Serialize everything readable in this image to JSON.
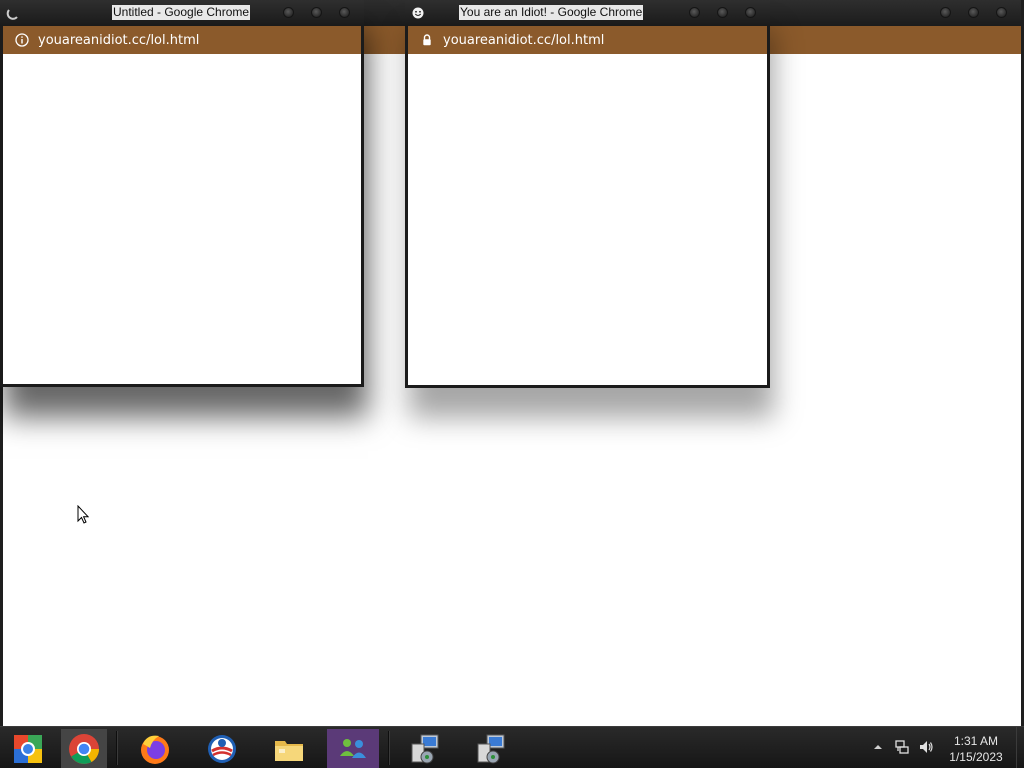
{
  "popups": [
    {
      "title": "Untitled - Google Chrome",
      "url": "youareanidiot.cc/lol.html",
      "title_icon": "loading-spinner-icon",
      "url_icon": "info-icon"
    },
    {
      "title": "You are an Idiot! - Google Chrome",
      "url": "youareanidiot.cc/lol.html",
      "title_icon": "smiley-face-icon",
      "url_icon": "lock-icon"
    }
  ],
  "colors": {
    "urlbar": "#8b5a2b",
    "titlebar": "#1e1e1e",
    "taskbar": "#1f1f1f",
    "content": "#ffffff"
  },
  "taskbar": {
    "items": [
      {
        "name": "start-button",
        "icon": "start-orb-icon"
      },
      {
        "name": "chrome",
        "icon": "chrome-icon",
        "active": true
      },
      {
        "name": "firefox",
        "icon": "firefox-icon"
      },
      {
        "name": "outlook",
        "icon": "outlook-icon"
      },
      {
        "name": "file-explorer",
        "icon": "folder-icon"
      },
      {
        "name": "messenger",
        "icon": "people-icon",
        "active": true
      },
      {
        "name": "installer-1",
        "icon": "installer-icon"
      },
      {
        "name": "installer-2",
        "icon": "installer-icon"
      }
    ],
    "tray": {
      "icons": [
        "show-hidden-icons-icon",
        "network-icon",
        "volume-icon"
      ]
    },
    "clock": {
      "time": "1:31 AM",
      "date": "1/15/2023"
    }
  }
}
